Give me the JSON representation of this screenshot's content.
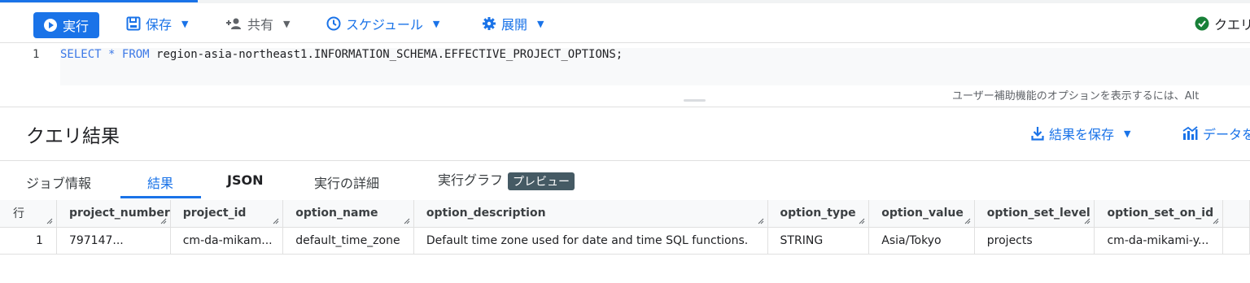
{
  "toolbar": {
    "run_label": "実行",
    "save_label": "保存",
    "share_label": "共有",
    "schedule_label": "スケジュール",
    "deploy_label": "展開",
    "status_label": "クエリ"
  },
  "editor": {
    "line_number": "1",
    "kw_select": "SELECT",
    "star": "*",
    "kw_from": "FROM",
    "table_ref": "region-asia-northeast1.INFORMATION_SCHEMA.EFFECTIVE_PROJECT_OPTIONS;",
    "accessibility_hint": "ユーザー補助機能のオプションを表示するには、Alt"
  },
  "results": {
    "title": "クエリ結果",
    "save_results_label": "結果を保存",
    "explore_label": "データを"
  },
  "tabs": [
    {
      "label": "ジョブ情報"
    },
    {
      "label": "結果"
    },
    {
      "label": "JSON"
    },
    {
      "label": "実行の詳細"
    },
    {
      "label": "実行グラフ",
      "badge": "プレビュー"
    }
  ],
  "table": {
    "row_header": "行",
    "columns": [
      "project_number",
      "project_id",
      "option_name",
      "option_description",
      "option_type",
      "option_value",
      "option_set_level",
      "option_set_on_id"
    ],
    "rows": [
      [
        "1",
        "797147...",
        "cm-da-mikam...",
        "default_time_zone",
        "Default time zone used for date and time SQL functions.",
        "STRING",
        "Asia/Tokyo",
        "projects",
        "cm-da-mikami-y..."
      ]
    ]
  },
  "colors": {
    "accent": "#1a73e8",
    "ok": "#188038",
    "badge": "#455a64"
  }
}
